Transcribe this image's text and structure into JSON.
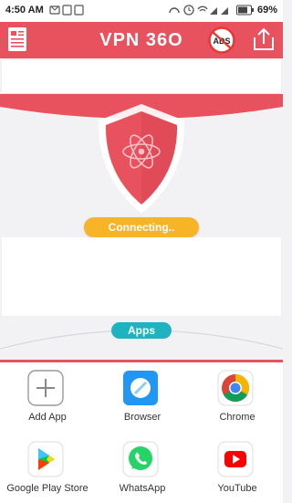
{
  "status_bar": {
    "time": "4:50 AM",
    "battery_percent": "69%"
  },
  "header": {
    "title": "VPN 36O",
    "ads_label": "ADS"
  },
  "vpn": {
    "status_text": "Connecting..",
    "apps_label": "Apps"
  },
  "apps": [
    {
      "label": "Add App"
    },
    {
      "label": "Browser"
    },
    {
      "label": "Chrome"
    },
    {
      "label": "Google Play Store"
    },
    {
      "label": "WhatsApp"
    },
    {
      "label": "YouTube"
    }
  ],
  "colors": {
    "brand_red": "#e8525e",
    "status_yellow": "#f8b427",
    "apps_teal": "#1fb3c2"
  },
  "icons": {
    "header_left": "document-icon",
    "header_ads": "no-ads-icon",
    "header_right": "share-icon",
    "shield": "shield-atom-icon"
  }
}
